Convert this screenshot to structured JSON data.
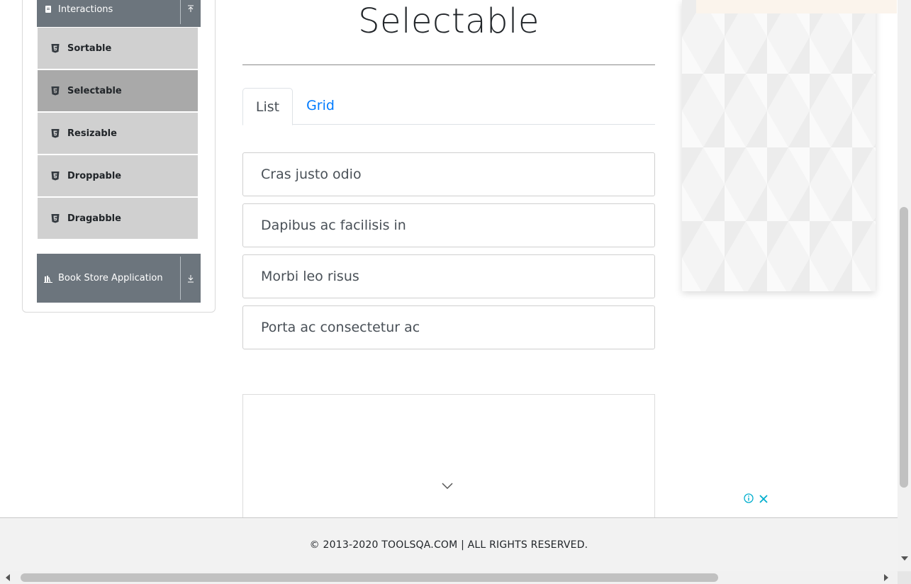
{
  "sidebar": {
    "interactions_header": "Interactions",
    "items": [
      {
        "label": "Sortable",
        "icon": "html5-icon"
      },
      {
        "label": "Selectable",
        "icon": "html5-icon",
        "active": true
      },
      {
        "label": "Resizable",
        "icon": "html5-icon"
      },
      {
        "label": "Droppable",
        "icon": "html5-icon"
      },
      {
        "label": "Dragabble",
        "icon": "html5-icon"
      }
    ],
    "book_store_header": "Book Store Application"
  },
  "main": {
    "title": "Selectable",
    "tabs": [
      {
        "label": "List",
        "active": true
      },
      {
        "label": "Grid",
        "active": false
      }
    ],
    "list_items": [
      "Cras justo odio",
      "Dapibus ac facilisis in",
      "Morbi leo risus",
      "Porta ac consectetur ac"
    ]
  },
  "footer": {
    "text": "© 2013-2020 TOOLSQA.COM | ALL RIGHTS RESERVED."
  },
  "colors": {
    "sidebar_header": "#6c757d",
    "menu_item": "#d0d0d0",
    "menu_item_active": "#a9a9a9",
    "link": "#007bff",
    "ad_icon": "#00aecd"
  }
}
